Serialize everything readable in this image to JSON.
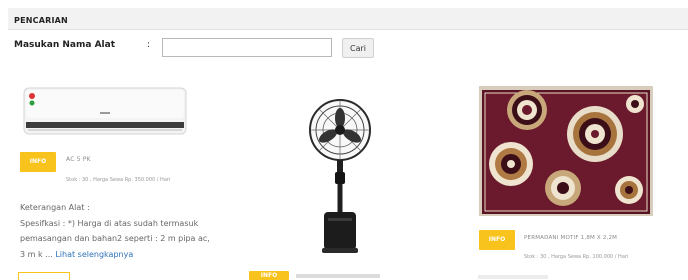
{
  "section": {
    "title": "PENCARIAN"
  },
  "search": {
    "label": "Masukan Nama Alat",
    "colon": ":",
    "value": "",
    "placeholder": "",
    "button_label": "Cari"
  },
  "products": [
    {
      "name": "AC 5 PK",
      "info_label": "INFO",
      "meta": "Stok : 30 , Harga Sewa Rp. 350.000 / Hari",
      "description_heading": "Keterangan Alat :",
      "description_lines": [
        "Spesifkasi : *) Harga di atas sudah termasuk",
        "pemasangan dan bahan2 seperti : 2 m pipa ac,",
        "3 m k ..."
      ],
      "read_more": "Lihat selengkapnya"
    },
    {
      "name": "",
      "info_label": "INFO"
    },
    {
      "name": "PERMADANI MOTIF 1,8M X 2,2M",
      "info_label": "INFO",
      "meta": "Stok : 30 , Harga Sewa Rp. 100.000 / Hari"
    }
  ],
  "colors": {
    "accent": "#f7c31c",
    "link": "#2f73b9",
    "header_bg": "#f2f2f2"
  }
}
